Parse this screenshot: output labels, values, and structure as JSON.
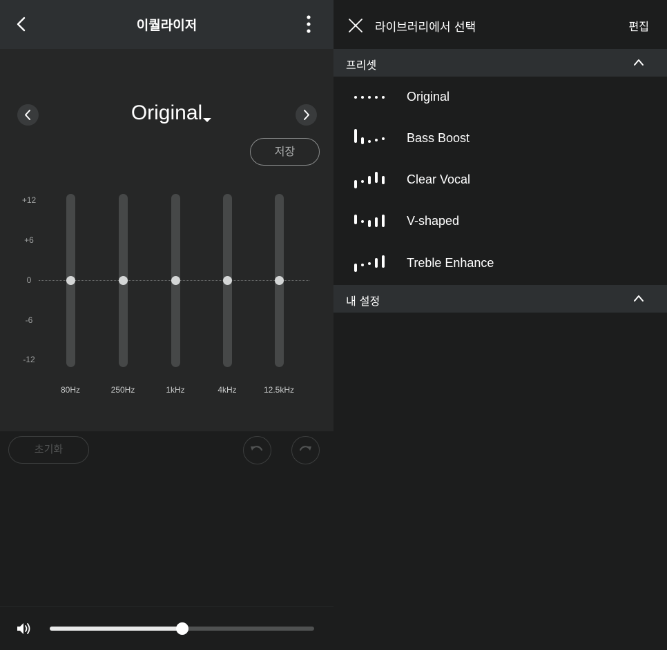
{
  "equalizer": {
    "title": "이퀄라이저",
    "preset_name": "Original",
    "save_label": "저장",
    "db_labels": [
      "+12",
      "+6",
      "0",
      "-6",
      "-12"
    ],
    "bands": [
      {
        "label": "80Hz",
        "gain_db": 0
      },
      {
        "label": "250Hz",
        "gain_db": 0
      },
      {
        "label": "1kHz",
        "gain_db": 0
      },
      {
        "label": "4kHz",
        "gain_db": 0
      },
      {
        "label": "12.5kHz",
        "gain_db": 0
      }
    ],
    "reset_label": "초기화",
    "volume_fraction": 0.5
  },
  "library": {
    "title": "라이브러리에서 선택",
    "edit_label": "편집",
    "presets_section": "프리셋",
    "my_settings_section": "내 설정",
    "presets": [
      {
        "label": "Original",
        "icon": "preset-original-icon"
      },
      {
        "label": "Bass Boost",
        "icon": "preset-bass-boost-icon"
      },
      {
        "label": "Clear Vocal",
        "icon": "preset-clear-vocal-icon"
      },
      {
        "label": "V-shaped",
        "icon": "preset-v-shaped-icon"
      },
      {
        "label": "Treble Enhance",
        "icon": "preset-treble-enhance-icon"
      }
    ]
  },
  "colors": {
    "header_bg": "#2d3032",
    "panel_bg": "#1c1d1d",
    "eq_bg": "#262727",
    "track": "#464848",
    "thumb": "#d4d6d6"
  }
}
